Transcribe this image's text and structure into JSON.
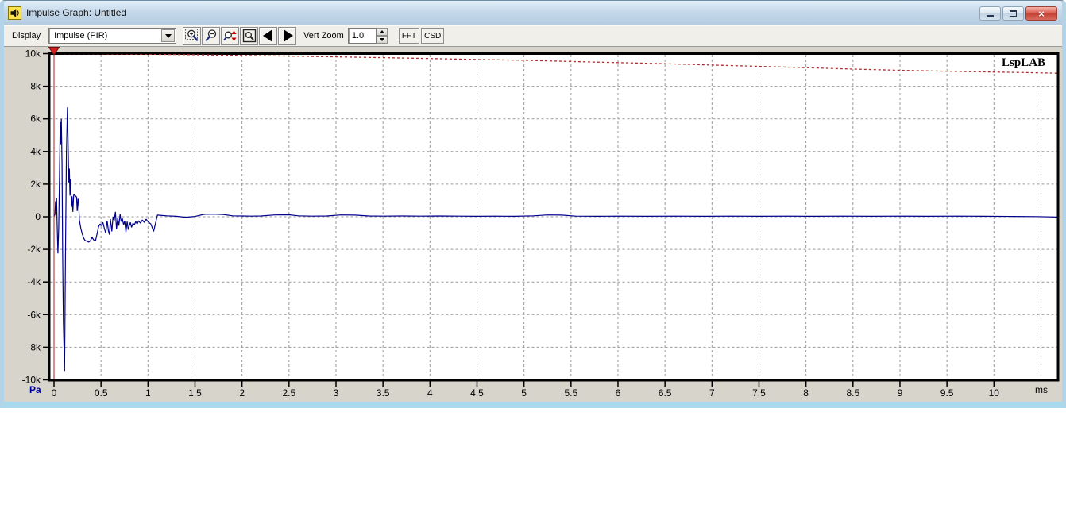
{
  "window": {
    "title": "Impulse Graph: Untitled",
    "icon": "speaker-icon",
    "controls": {
      "minimize": "minimize-button",
      "maximize": "maximize-button",
      "close": "close-button"
    }
  },
  "toolbar": {
    "display_label": "Display",
    "display_value": "Impulse (PIR)",
    "icon_buttons": [
      "zoom-in-selection-icon",
      "zoom-out-icon",
      "zoom-reset-icon",
      "zoom-preview-icon",
      "scroll-left-icon",
      "scroll-right-icon"
    ],
    "vert_zoom_label": "Vert Zoom",
    "vert_zoom_value": "1.0",
    "fft_label": "FFT",
    "csd_label": "CSD"
  },
  "chart": {
    "brand": "LspLAB",
    "y_unit": "Pa",
    "x_unit": "ms"
  },
  "colors": {
    "impulse": "#00008b",
    "envelope": "#a33333",
    "cursor": "#aa2222",
    "marker_fill": "#cf1f1f",
    "marker_stroke": "#7c0c0c",
    "grid": "#999999",
    "frame": "#000000",
    "plot_bg": "#ffffff"
  },
  "chart_data": {
    "type": "line",
    "title": "Impulse Graph: Untitled",
    "xlabel": "ms",
    "ylabel": "Pa",
    "xlim": [
      0,
      10.67
    ],
    "ylim": [
      -10000,
      10000
    ],
    "grid": true,
    "x_ticks": [
      0,
      0.5,
      1,
      1.5,
      2,
      2.5,
      3,
      3.5,
      4,
      4.5,
      5,
      5.5,
      6,
      6.5,
      7,
      7.5,
      8,
      8.5,
      9,
      9.5,
      10
    ],
    "x_tick_labels": [
      "0",
      "0.5",
      "1",
      "1.5",
      "2",
      "2.5",
      "3",
      "3.5",
      "4",
      "4.5",
      "5",
      "5.5",
      "6",
      "6.5",
      "7",
      "7.5",
      "8",
      "8.5",
      "9",
      "9.5",
      "10"
    ],
    "x_gridlines": [
      0.5,
      1,
      1.5,
      2,
      2.5,
      3,
      3.5,
      4,
      4.5,
      5,
      5.5,
      6,
      6.5,
      7,
      7.5,
      8,
      8.5,
      9,
      9.5,
      10,
      10.5
    ],
    "y_ticks": [
      10000,
      8000,
      6000,
      4000,
      2000,
      0,
      -2000,
      -4000,
      -6000,
      -8000,
      -10000
    ],
    "y_tick_labels": [
      "10k",
      "8k",
      "6k",
      "4k",
      "2k",
      "0",
      "-2k",
      "-4k",
      "-6k",
      "-8k",
      "-10k"
    ],
    "y_gridlines": [
      8000,
      6000,
      4000,
      2000,
      0,
      -2000,
      -4000,
      -6000,
      -8000
    ],
    "cursor": {
      "t": 0
    },
    "series": [
      {
        "name": "impulse",
        "style": "solid",
        "points": [
          [
            0,
            0
          ],
          [
            0.01,
            150
          ],
          [
            0.016,
            950
          ],
          [
            0.021,
            350
          ],
          [
            0.027,
            1150
          ],
          [
            0.033,
            -400
          ],
          [
            0.041,
            -2250
          ],
          [
            0.05,
            -700
          ],
          [
            0.058,
            2500
          ],
          [
            0.066,
            5800
          ],
          [
            0.071,
            4400
          ],
          [
            0.078,
            6000
          ],
          [
            0.085,
            3200
          ],
          [
            0.092,
            -2500
          ],
          [
            0.1,
            -6500
          ],
          [
            0.112,
            -9450
          ],
          [
            0.122,
            -2500
          ],
          [
            0.132,
            3800
          ],
          [
            0.143,
            6700
          ],
          [
            0.15,
            4600
          ],
          [
            0.157,
            2100
          ],
          [
            0.163,
            2950
          ],
          [
            0.17,
            1300
          ],
          [
            0.177,
            2300
          ],
          [
            0.185,
            600
          ],
          [
            0.193,
            1250
          ],
          [
            0.2,
            300
          ],
          [
            0.21,
            1350
          ],
          [
            0.225,
            1300
          ],
          [
            0.24,
            1200
          ],
          [
            0.247,
            350
          ],
          [
            0.255,
            1100
          ],
          [
            0.262,
            900
          ],
          [
            0.27,
            -200
          ],
          [
            0.285,
            -700
          ],
          [
            0.3,
            -1050
          ],
          [
            0.315,
            -1300
          ],
          [
            0.33,
            -1450
          ],
          [
            0.35,
            -1500
          ],
          [
            0.37,
            -1550
          ],
          [
            0.39,
            -1450
          ],
          [
            0.405,
            -1250
          ],
          [
            0.42,
            -1400
          ],
          [
            0.44,
            -1500
          ],
          [
            0.46,
            -1000
          ],
          [
            0.475,
            -600
          ],
          [
            0.49,
            -450
          ],
          [
            0.5,
            -550
          ],
          [
            0.52,
            -350
          ],
          [
            0.535,
            -700
          ],
          [
            0.55,
            -1000
          ],
          [
            0.565,
            -250
          ],
          [
            0.578,
            -850
          ],
          [
            0.59,
            -1100
          ],
          [
            0.6,
            -150
          ],
          [
            0.615,
            -900
          ],
          [
            0.628,
            0
          ],
          [
            0.64,
            -250
          ],
          [
            0.653,
            300
          ],
          [
            0.665,
            -750
          ],
          [
            0.678,
            -100
          ],
          [
            0.69,
            -550
          ],
          [
            0.703,
            150
          ],
          [
            0.715,
            -300
          ],
          [
            0.727,
            -100
          ],
          [
            0.74,
            -500
          ],
          [
            0.752,
            -250
          ],
          [
            0.765,
            -950
          ],
          [
            0.778,
            -300
          ],
          [
            0.79,
            -800
          ],
          [
            0.8,
            -550
          ],
          [
            0.812,
            -350
          ],
          [
            0.825,
            -650
          ],
          [
            0.84,
            -400
          ],
          [
            0.855,
            -500
          ],
          [
            0.87,
            -300
          ],
          [
            0.885,
            -450
          ],
          [
            0.9,
            -250
          ],
          [
            0.92,
            -400
          ],
          [
            0.94,
            -200
          ],
          [
            0.96,
            -350
          ],
          [
            0.98,
            -150
          ],
          [
            1.0,
            -300
          ],
          [
            1.03,
            -450
          ],
          [
            1.06,
            -900
          ],
          [
            1.08,
            -400
          ],
          [
            1.1,
            100
          ],
          [
            1.15,
            80
          ],
          [
            1.2,
            60
          ],
          [
            1.3,
            30
          ],
          [
            1.4,
            -30
          ],
          [
            1.5,
            20
          ],
          [
            1.6,
            150
          ],
          [
            1.7,
            160
          ],
          [
            1.8,
            140
          ],
          [
            1.9,
            60
          ],
          [
            2.0,
            50
          ],
          [
            2.1,
            40
          ],
          [
            2.2,
            50
          ],
          [
            2.35,
            110
          ],
          [
            2.5,
            120
          ],
          [
            2.6,
            60
          ],
          [
            2.75,
            40
          ],
          [
            2.9,
            50
          ],
          [
            3.05,
            110
          ],
          [
            3.2,
            100
          ],
          [
            3.35,
            50
          ],
          [
            3.5,
            40
          ],
          [
            3.7,
            50
          ],
          [
            3.9,
            40
          ],
          [
            4.1,
            50
          ],
          [
            4.3,
            40
          ],
          [
            4.5,
            30
          ],
          [
            4.7,
            40
          ],
          [
            4.9,
            30
          ],
          [
            5.1,
            60
          ],
          [
            5.25,
            110
          ],
          [
            5.4,
            100
          ],
          [
            5.55,
            40
          ],
          [
            5.8,
            30
          ],
          [
            6.0,
            40
          ],
          [
            6.3,
            30
          ],
          [
            6.6,
            40
          ],
          [
            6.9,
            30
          ],
          [
            7.2,
            40
          ],
          [
            7.5,
            30
          ],
          [
            7.8,
            40
          ],
          [
            8.1,
            30
          ],
          [
            8.4,
            40
          ],
          [
            8.7,
            30
          ],
          [
            9.0,
            40
          ],
          [
            9.3,
            30
          ],
          [
            9.6,
            40
          ],
          [
            9.9,
            30
          ],
          [
            10.2,
            20
          ],
          [
            10.45,
            10
          ],
          [
            10.67,
            -20
          ]
        ]
      },
      {
        "name": "peak-envelope",
        "style": "dotted",
        "points": [
          [
            0,
            10000
          ],
          [
            0.5,
            9990
          ],
          [
            1,
            9960
          ],
          [
            1.5,
            9930
          ],
          [
            2,
            9890
          ],
          [
            2.5,
            9850
          ],
          [
            3,
            9800
          ],
          [
            3.5,
            9750
          ],
          [
            4,
            9700
          ],
          [
            4.5,
            9640
          ],
          [
            5,
            9590
          ],
          [
            5.5,
            9520
          ],
          [
            6,
            9450
          ],
          [
            6.5,
            9380
          ],
          [
            7,
            9300
          ],
          [
            7.5,
            9220
          ],
          [
            8,
            9140
          ],
          [
            8.5,
            9050
          ],
          [
            9,
            8980
          ],
          [
            9.5,
            8920
          ],
          [
            10,
            8870
          ],
          [
            10.35,
            8835
          ],
          [
            10.67,
            8800
          ]
        ]
      }
    ]
  }
}
